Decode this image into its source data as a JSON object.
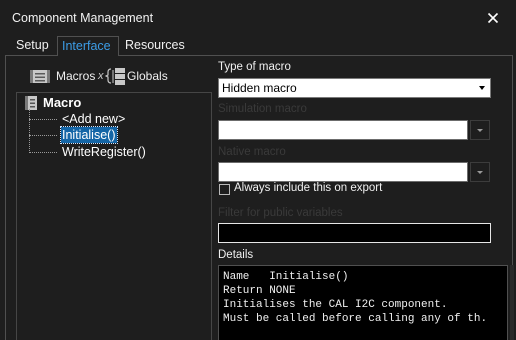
{
  "window": {
    "title": "Component Management",
    "close_icon": "close-icon"
  },
  "tabs": [
    {
      "label": "Setup",
      "active": false
    },
    {
      "label": "Interface",
      "active": true
    },
    {
      "label": "Resources",
      "active": false
    }
  ],
  "left_toolbar": {
    "macros_label": "Macros",
    "macros_icon": "macros-icon",
    "globals_prefix": "x",
    "globals_label": "Globals",
    "globals_icon": "globals-tree-icon"
  },
  "tree": {
    "root": "Macro",
    "root_icon": "macro-list-icon",
    "items": [
      {
        "label": "<Add new>",
        "selected": false
      },
      {
        "label": "Initialise()",
        "selected": true
      },
      {
        "label": "WriteRegister()",
        "selected": false
      }
    ]
  },
  "type_of_macro": {
    "label": "Type of macro",
    "value": "Hidden macro"
  },
  "simulation_macro": {
    "label": "Simulation macro",
    "value": ""
  },
  "native_macro": {
    "label": "Native macro",
    "value": ""
  },
  "export_checkbox": {
    "label": "Always include this on export",
    "checked": false
  },
  "filter": {
    "label": "Filter for public variables",
    "value": ""
  },
  "details": {
    "label": "Details",
    "lines": [
      "Name   Initialise()",
      "Return NONE",
      "Initialises the CAL I2C component.",
      "Must be called before calling any of th."
    ]
  },
  "colors": {
    "background": "#1e1e1e",
    "accent": "#3c9ce6",
    "selection": "#1465a6",
    "disabled_text": "#3a3a3a"
  }
}
